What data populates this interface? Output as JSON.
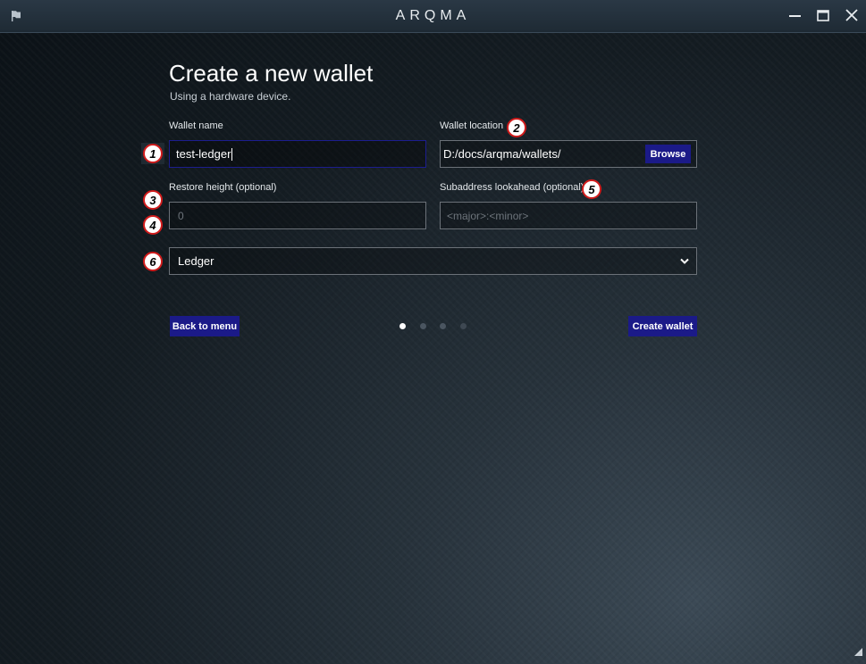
{
  "window": {
    "logo_text": "ARQMA",
    "controls": [
      "minimize-icon",
      "maximize-icon",
      "close-icon"
    ]
  },
  "page": {
    "title": "Create a new wallet",
    "subtitle": "Using a hardware device."
  },
  "form": {
    "wallet_name": {
      "label": "Wallet name",
      "value": "test-ledger"
    },
    "wallet_location": {
      "label": "Wallet location",
      "value": "D:/docs/arqma/wallets/",
      "browse_label": "Browse"
    },
    "restore_height": {
      "label": "Restore height (optional)",
      "placeholder": "0"
    },
    "subaddress_lookahead": {
      "label": "Subaddress lookahead (optional)",
      "placeholder": "<major>:<minor>"
    },
    "device": {
      "selected": "Ledger"
    }
  },
  "actions": {
    "back_label": "Back to menu",
    "create_label": "Create wallet"
  },
  "pager": {
    "total": 4,
    "current": 1
  },
  "annotations": [
    "1",
    "2",
    "3",
    "4",
    "5",
    "6"
  ],
  "colors": {
    "accent": "#1b1a88",
    "badge_border": "#d11b1b",
    "dot_active": "#ffffff",
    "dot_inactive": "#4a5560"
  }
}
